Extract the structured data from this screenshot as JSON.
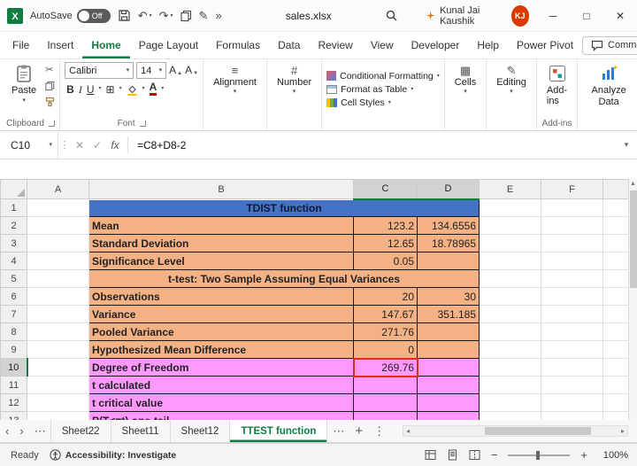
{
  "colors": {
    "excel_green": "#107C41",
    "title_fill": "#4472C4",
    "orange_fill": "#F4B183",
    "pink_fill": "#FF99FF",
    "selection_red": "#E02B20",
    "avatar_bg": "#D83B01"
  },
  "title_bar": {
    "autosave_label": "AutoSave",
    "autosave_state": "Off",
    "filename": "sales.xlsx",
    "user_name": "Kunal Jai Kaushik",
    "user_initials": "KJ"
  },
  "ribbon_tabs": {
    "items": [
      {
        "label": "File"
      },
      {
        "label": "Insert"
      },
      {
        "label": "Home",
        "active": true
      },
      {
        "label": "Page Layout"
      },
      {
        "label": "Formulas"
      },
      {
        "label": "Data"
      },
      {
        "label": "Review"
      },
      {
        "label": "View"
      },
      {
        "label": "Developer"
      },
      {
        "label": "Help"
      },
      {
        "label": "Power Pivot"
      }
    ],
    "comments_label": "Comments"
  },
  "ribbon": {
    "paste_label": "Paste",
    "font_name": "Calibri",
    "font_size": "14",
    "alignment_label": "Alignment",
    "number_label": "Number",
    "conditional_formatting_label": "Conditional Formatting",
    "format_as_table_label": "Format as Table",
    "cell_styles_label": "Cell Styles",
    "cells_label": "Cells",
    "editing_label": "Editing",
    "addins_label": "Add-ins",
    "analyze_data_label": "Analyze Data",
    "group_labels": {
      "clipboard": "Clipboard",
      "font": "Font",
      "addins": "Add-ins"
    }
  },
  "formula_bar": {
    "name_box": "C10",
    "fx_label": "fx",
    "formula": "=C8+D8-2"
  },
  "sheet": {
    "selected_cell": "C10",
    "columns": [
      "A",
      "B",
      "C",
      "D",
      "E",
      "F"
    ],
    "highlight_columns": [
      "C",
      "D"
    ],
    "highlight_row": 10,
    "rows": [
      {
        "num": 1,
        "type": "title",
        "merge": true,
        "b": "TDIST function"
      },
      {
        "num": 2,
        "type": "orange",
        "b": "Mean",
        "c": "123.2",
        "d": "134.6556"
      },
      {
        "num": 3,
        "type": "orange",
        "b": "Standard Deviation",
        "c": "12.65",
        "d": "18.78965"
      },
      {
        "num": 4,
        "type": "orange",
        "b": "Significance Level",
        "c": "0.05",
        "d": ""
      },
      {
        "num": 5,
        "type": "subtitle",
        "merge": true,
        "b": "t-test: Two Sample Assuming Equal Variances"
      },
      {
        "num": 6,
        "type": "orange",
        "b": "Observations",
        "c": "20",
        "d": "30"
      },
      {
        "num": 7,
        "type": "orange",
        "b": "Variance",
        "c": "147.67",
        "d": "351.185"
      },
      {
        "num": 8,
        "type": "orange",
        "b": "Pooled Variance",
        "c": "271.76",
        "d": ""
      },
      {
        "num": 9,
        "type": "orange",
        "b": "Hypothesized Mean Difference",
        "c": "0",
        "d": ""
      },
      {
        "num": 10,
        "type": "pink",
        "b": "Degree of Freedom",
        "c": "269.76",
        "d": "",
        "selected": true
      },
      {
        "num": 11,
        "type": "pink",
        "b": "t calculated",
        "c": "",
        "d": ""
      },
      {
        "num": 12,
        "type": "pink",
        "b": "t critical value",
        "c": "",
        "d": ""
      },
      {
        "num": 13,
        "type": "pink",
        "b": "P(T<=t) one-tail",
        "c": "",
        "d": ""
      }
    ]
  },
  "sheet_tabs": {
    "tabs": [
      {
        "label": "Sheet22"
      },
      {
        "label": "Sheet11"
      },
      {
        "label": "Sheet12"
      },
      {
        "label": "TTEST function",
        "active": true
      }
    ]
  },
  "status_bar": {
    "mode": "Ready",
    "accessibility": "Accessibility: Investigate",
    "zoom": "100%"
  }
}
